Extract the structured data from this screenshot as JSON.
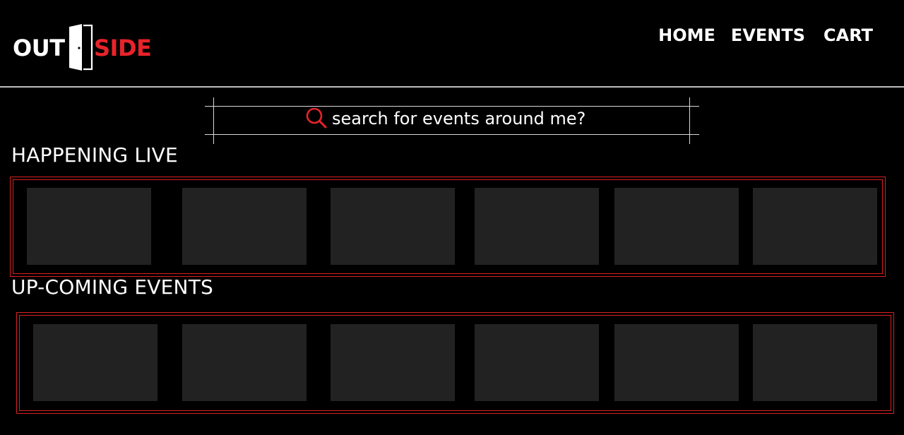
{
  "logo": {
    "part1": "OUT",
    "part2": "SIDE",
    "primary_color": "#ffffff",
    "accent_color": "#e8232a"
  },
  "nav": {
    "home": "HOME",
    "events": "EVENTS",
    "cart": "CART"
  },
  "search": {
    "placeholder": "search for events around me?",
    "icon": "search-icon",
    "icon_color": "#e8232a"
  },
  "sections": {
    "live": {
      "title": "HAPPENING LIVE",
      "card_count": 6
    },
    "upcoming": {
      "title": "UP-COMING EVENTS",
      "card_count": 6
    }
  },
  "colors": {
    "background": "#000000",
    "card": "#222222",
    "frame": "#d82020",
    "divider": "#bdbdbd"
  }
}
